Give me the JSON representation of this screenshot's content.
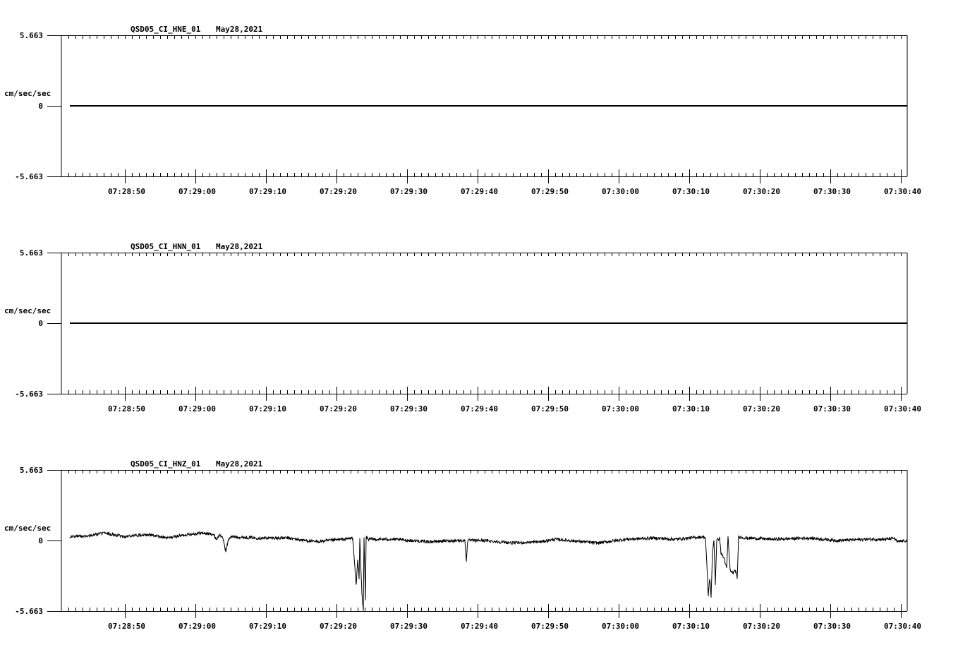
{
  "chart_data": [
    {
      "type": "line",
      "title": "QSD05_CI_HNE_01",
      "date": "May28,2021",
      "ylabel": "cm/sec/sec",
      "ylim": [
        -5.663,
        5.663
      ],
      "y_tick_labels": [
        "5.663",
        "0",
        "-5.663"
      ],
      "x_start": "07:28:41",
      "x_range_seconds": [
        0,
        119.9
      ],
      "x_tick_labels": [
        "07:28:50",
        "07:29:00",
        "07:29:10",
        "07:29:20",
        "07:29:30",
        "07:29:40",
        "07:29:50",
        "07:30:00",
        "07:30:10",
        "07:30:20",
        "07:30:30",
        "07:30:40"
      ],
      "noise": 0,
      "points": [
        [
          1.2,
          0
        ],
        [
          119.9,
          0
        ]
      ]
    },
    {
      "type": "line",
      "title": "QSD05_CI_HNN_01",
      "date": "May28,2021",
      "ylabel": "cm/sec/sec",
      "ylim": [
        -5.663,
        5.663
      ],
      "y_tick_labels": [
        "5.663",
        "0",
        "-5.663"
      ],
      "x_start": "07:28:41",
      "x_range_seconds": [
        0,
        119.9
      ],
      "x_tick_labels": [
        "07:28:50",
        "07:29:00",
        "07:29:10",
        "07:29:20",
        "07:29:30",
        "07:29:40",
        "07:29:50",
        "07:30:00",
        "07:30:10",
        "07:30:20",
        "07:30:30",
        "07:30:40"
      ],
      "noise": 0,
      "points": [
        [
          1.2,
          0
        ],
        [
          119.9,
          0
        ]
      ]
    },
    {
      "type": "line",
      "title": "QSD05_CI_HNZ_01",
      "date": "May28,2021",
      "ylabel": "cm/sec/sec",
      "ylim": [
        -5.663,
        5.663
      ],
      "y_tick_labels": [
        "5.663",
        "0",
        "-5.663"
      ],
      "x_start": "07:28:41",
      "x_range_seconds": [
        0,
        119.9
      ],
      "x_tick_labels": [
        "07:28:50",
        "07:29:00",
        "07:29:10",
        "07:29:20",
        "07:29:30",
        "07:29:40",
        "07:29:50",
        "07:30:00",
        "07:30:10",
        "07:30:20",
        "07:30:30",
        "07:30:40"
      ],
      "noise": 0.12,
      "points": [
        [
          1.2,
          0.3
        ],
        [
          4,
          0.4
        ],
        [
          6,
          0.6
        ],
        [
          9,
          0.3
        ],
        [
          12,
          0.5
        ],
        [
          15,
          0.2
        ],
        [
          18,
          0.5
        ],
        [
          20,
          0.6
        ],
        [
          21.5,
          0.5
        ],
        [
          22,
          0.1
        ],
        [
          22.5,
          0.5
        ],
        [
          23,
          0.0
        ],
        [
          23.3,
          -0.9
        ],
        [
          23.7,
          0.1
        ],
        [
          24,
          0.3
        ],
        [
          28,
          0.2
        ],
        [
          32,
          0.2
        ],
        [
          36,
          -0.1
        ],
        [
          40,
          0.1
        ],
        [
          41.3,
          0.2
        ],
        [
          41.4,
          -0.5
        ],
        [
          41.6,
          -2.2
        ],
        [
          41.8,
          -3.6
        ],
        [
          42,
          -1.5
        ],
        [
          42.2,
          -3.0
        ],
        [
          42.3,
          0.2
        ],
        [
          42.6,
          -4.3
        ],
        [
          42.8,
          -5.66
        ],
        [
          42.9,
          0.2
        ],
        [
          43.1,
          -4.7
        ],
        [
          43.2,
          0.3
        ],
        [
          43.5,
          0.1
        ],
        [
          47,
          0.1
        ],
        [
          52,
          -0.1
        ],
        [
          56,
          0.0
        ],
        [
          57.2,
          0.0
        ],
        [
          57.4,
          -1.6
        ],
        [
          57.6,
          0.0
        ],
        [
          60,
          0.0
        ],
        [
          64,
          -0.2
        ],
        [
          68,
          -0.1
        ],
        [
          70,
          0.1
        ],
        [
          72,
          0.0
        ],
        [
          76,
          -0.2
        ],
        [
          80,
          0.1
        ],
        [
          84,
          0.2
        ],
        [
          87,
          0.1
        ],
        [
          91,
          0.3
        ],
        [
          91.3,
          0.2
        ],
        [
          91.5,
          -2.0
        ],
        [
          91.7,
          -4.4
        ],
        [
          91.9,
          -3.0
        ],
        [
          92.1,
          -4.5
        ],
        [
          92.3,
          -1.0
        ],
        [
          92.5,
          0.1
        ],
        [
          92.7,
          -3.5
        ],
        [
          92.9,
          0.0
        ],
        [
          93.3,
          0.2
        ],
        [
          93.5,
          -1.0
        ],
        [
          94,
          -1.5
        ],
        [
          94.3,
          -2.3
        ],
        [
          94.5,
          0.3
        ],
        [
          94.8,
          -2.4
        ],
        [
          95.2,
          -2.6
        ],
        [
          95.6,
          -2.4
        ],
        [
          95.8,
          -3.1
        ],
        [
          96,
          0.3
        ],
        [
          97,
          0.2
        ],
        [
          101,
          0.1
        ],
        [
          106,
          0.2
        ],
        [
          110,
          0.0
        ],
        [
          114,
          0.1
        ],
        [
          117,
          0.1
        ],
        [
          118,
          0.2
        ],
        [
          118.5,
          -0.1
        ],
        [
          119.9,
          0.0
        ]
      ]
    }
  ]
}
